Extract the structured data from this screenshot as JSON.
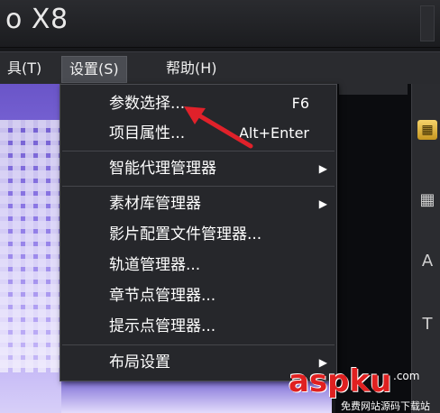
{
  "window": {
    "title": "o X8"
  },
  "menubar": {
    "items": [
      {
        "label": "具(T)"
      },
      {
        "label": "设置(S)"
      },
      {
        "label": "帮助(H)"
      }
    ]
  },
  "dropdown": {
    "items": [
      {
        "label": "参数选择...",
        "shortcut": "F6"
      },
      {
        "label": "项目属性...",
        "shortcut": "Alt+Enter"
      },
      {
        "label": "智能代理管理器",
        "submenu": "▶"
      },
      {
        "label": "素材库管理器",
        "submenu": "▶"
      },
      {
        "label": "影片配置文件管理器..."
      },
      {
        "label": "轨道管理器..."
      },
      {
        "label": "章节点管理器..."
      },
      {
        "label": "提示点管理器..."
      },
      {
        "label": "布局设置",
        "submenu": "▶"
      }
    ]
  },
  "toolstrip": {
    "icons": [
      "media-icon",
      "grid-icon",
      "text-a-icon",
      "title-t-icon"
    ]
  },
  "watermark": {
    "main": "aspku",
    "tld": ".com",
    "sub": "免费网站源码下载站"
  },
  "colors": {
    "arrow": "#e0212a",
    "menu_bg": "#26272b",
    "active_menu": "#4a4c52"
  }
}
